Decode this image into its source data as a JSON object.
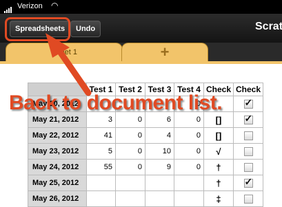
{
  "status": {
    "carrier": "Verizon",
    "wifi_icon": "wifi-icon"
  },
  "nav": {
    "spreadsheets_label": "Spreadsheets",
    "undo_label": "Undo",
    "title": "Scratch"
  },
  "tabs": {
    "sheet_label": "Sheet 1",
    "add_label": "+"
  },
  "table": {
    "headers": [
      "Test 1",
      "Test 2",
      "Test 3",
      "Test 4",
      "Check",
      "Check"
    ],
    "rows": [
      {
        "date": "May 20, 2012",
        "t1": "",
        "t2": "",
        "t3": "",
        "t4": "0",
        "sym": "",
        "checked": true
      },
      {
        "date": "May 21, 2012",
        "t1": "3",
        "t2": "0",
        "t3": "6",
        "t4": "0",
        "sym": "[]",
        "checked": true
      },
      {
        "date": "May 22, 2012",
        "t1": "41",
        "t2": "0",
        "t3": "4",
        "t4": "0",
        "sym": "[]",
        "checked": false
      },
      {
        "date": "May 23, 2012",
        "t1": "5",
        "t2": "0",
        "t3": "10",
        "t4": "0",
        "sym": "√",
        "checked": false
      },
      {
        "date": "May 24, 2012",
        "t1": "55",
        "t2": "0",
        "t3": "9",
        "t4": "0",
        "sym": "†",
        "checked": false
      },
      {
        "date": "May 25, 2012",
        "t1": "",
        "t2": "",
        "t3": "",
        "t4": "",
        "sym": "†",
        "checked": true
      },
      {
        "date": "May 26, 2012",
        "t1": "",
        "t2": "",
        "t3": "",
        "t4": "",
        "sym": "‡",
        "checked": false
      }
    ]
  },
  "annotation": {
    "text": "Back to document list.",
    "color": "#e04a23"
  }
}
